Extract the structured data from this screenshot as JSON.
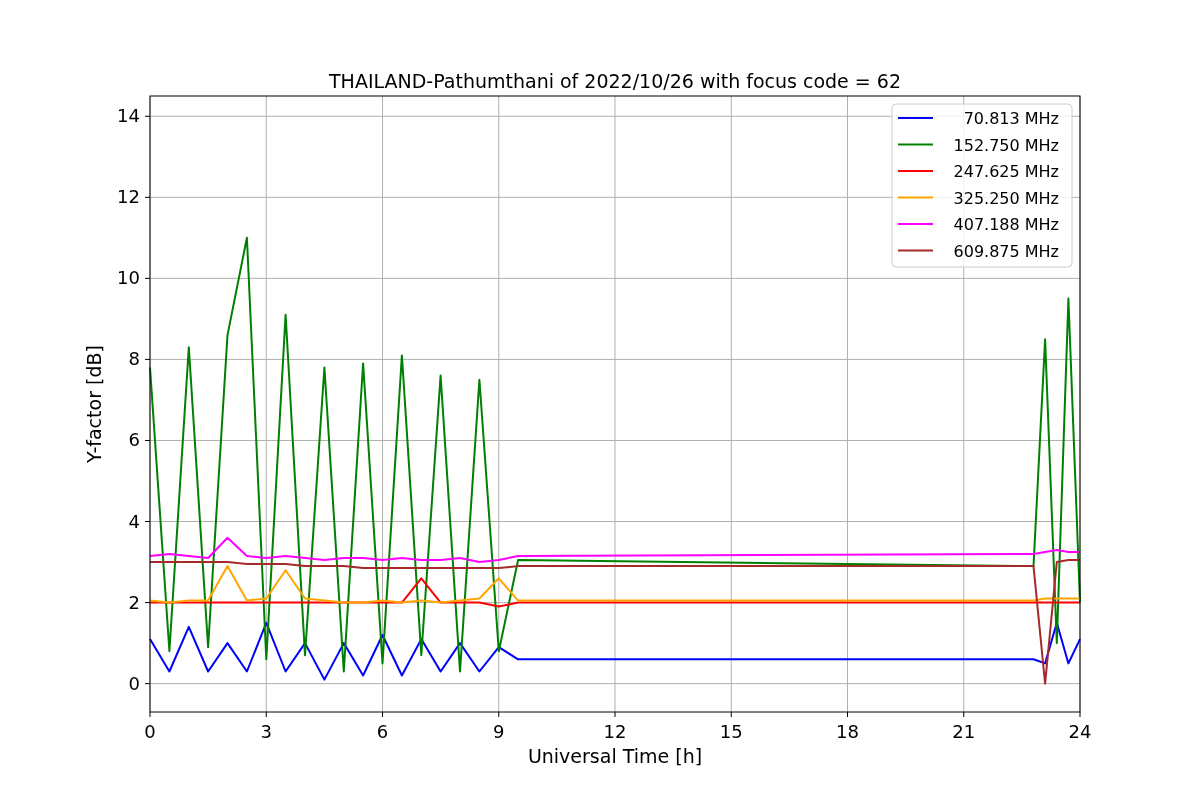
{
  "plot": {
    "chart_data": {
      "type": "line",
      "title": "THAILAND-Pathumthani of 2022/10/26 with focus code = 62",
      "xlabel": "Universal Time [h]",
      "ylabel": "Y-factor [dB]",
      "x": [
        0,
        0.5,
        1,
        1.5,
        2,
        2.5,
        3,
        3.5,
        4,
        4.5,
        5,
        5.5,
        6,
        6.5,
        7,
        7.5,
        8,
        8.5,
        9,
        9.5,
        22.8,
        23.1,
        23.4,
        23.7,
        24
      ],
      "series": [
        {
          "name": "70.813 MHz",
          "color": "#0000ff",
          "values": [
            1.1,
            0.3,
            1.4,
            0.3,
            1.0,
            0.3,
            1.5,
            0.3,
            1.0,
            0.1,
            1.0,
            0.2,
            1.2,
            0.2,
            1.1,
            0.3,
            1.0,
            0.3,
            0.9,
            0.6,
            0.6,
            0.5,
            1.5,
            0.5,
            1.1
          ]
        },
        {
          "name": "152.750 MHz",
          "color": "#008000",
          "values": [
            7.8,
            0.8,
            8.3,
            0.9,
            8.6,
            11.0,
            0.6,
            9.1,
            0.7,
            7.8,
            0.3,
            7.9,
            0.5,
            8.1,
            0.7,
            7.6,
            0.3,
            7.5,
            0.8,
            3.05,
            2.9,
            8.5,
            1.0,
            9.5,
            2.0
          ]
        },
        {
          "name": "247.625 MHz",
          "color": "#ff0000",
          "values": [
            2.0,
            2.0,
            2.0,
            2.0,
            2.0,
            2.0,
            2.0,
            2.0,
            2.0,
            2.0,
            2.0,
            2.0,
            2.0,
            2.0,
            2.6,
            2.0,
            2.0,
            2.0,
            1.9,
            2.0,
            2.0,
            2.0,
            2.0,
            2.0,
            2.0
          ]
        },
        {
          "name": "325.250 MHz",
          "color": "#ffa500",
          "values": [
            2.05,
            2.0,
            2.05,
            2.05,
            2.9,
            2.05,
            2.1,
            2.8,
            2.1,
            2.05,
            2.0,
            2.0,
            2.05,
            2.0,
            2.05,
            2.0,
            2.05,
            2.1,
            2.6,
            2.05,
            2.05,
            2.1,
            2.1,
            2.1,
            2.1
          ]
        },
        {
          "name": "407.188 MHz",
          "color": "#ff00ff",
          "values": [
            3.15,
            3.2,
            3.15,
            3.1,
            3.6,
            3.15,
            3.1,
            3.15,
            3.1,
            3.05,
            3.1,
            3.1,
            3.05,
            3.1,
            3.05,
            3.05,
            3.1,
            3.0,
            3.05,
            3.15,
            3.2,
            3.25,
            3.3,
            3.25,
            3.25
          ]
        },
        {
          "name": "609.875 MHz",
          "color": "#a52a2a",
          "values": [
            3.0,
            3.0,
            3.0,
            3.0,
            3.0,
            2.95,
            2.95,
            2.95,
            2.9,
            2.9,
            2.9,
            2.85,
            2.85,
            2.85,
            2.85,
            2.85,
            2.85,
            2.85,
            2.85,
            2.9,
            2.9,
            0.0,
            3.0,
            3.05,
            3.05
          ]
        }
      ],
      "xlim": [
        0,
        24
      ],
      "ylim": [
        -0.7,
        14.5
      ],
      "xticks": [
        0,
        3,
        6,
        9,
        12,
        15,
        18,
        21,
        24
      ],
      "yticks": [
        0,
        2,
        4,
        6,
        8,
        10,
        12,
        14
      ],
      "grid": true,
      "legend": true
    }
  }
}
